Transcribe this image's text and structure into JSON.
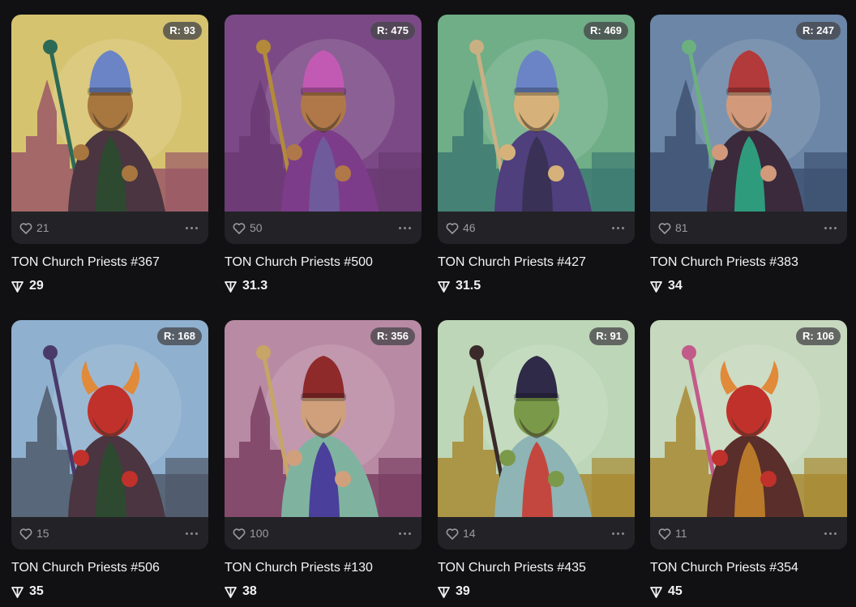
{
  "cards": [
    {
      "rank": "R: 93",
      "likes": "21",
      "title": "TON Church Priests #367",
      "price": "29",
      "bg": "#d6c36f",
      "horizon": "#9a5866",
      "robe": "#2d4a30",
      "coat": "#4a3541",
      "hat": "#6a84c6",
      "skin": "#a8763f",
      "staff": "#2d6a56",
      "figure": "priest"
    },
    {
      "rank": "R: 475",
      "likes": "50",
      "title": "TON Church Priests #500",
      "price": "31.3",
      "bg": "#7b4a86",
      "horizon": "#6b3a73",
      "robe": "#6f5a9c",
      "coat": "#7d3c8a",
      "hat": "#c25ab3",
      "skin": "#b07848",
      "staff": "#b38a3a",
      "figure": "priest"
    },
    {
      "rank": "R: 469",
      "likes": "46",
      "title": "TON Church Priests #427",
      "price": "31.5",
      "bg": "#6fae86",
      "horizon": "#3e7a72",
      "robe": "#3a3156",
      "coat": "#4f3f7d",
      "hat": "#6a84c6",
      "skin": "#d6b27a",
      "staff": "#c9b083",
      "figure": "priest"
    },
    {
      "rank": "R: 247",
      "likes": "81",
      "title": "TON Church Priests #383",
      "price": "34",
      "bg": "#6b86a7",
      "horizon": "#3e5272",
      "robe": "#2f9b7d",
      "coat": "#3a2a3c",
      "hat": "#b23a3a",
      "skin": "#d29a7a",
      "staff": "#6bb07e",
      "figure": "priest"
    },
    {
      "rank": "R: 168",
      "likes": "15",
      "title": "TON Church Priests #506",
      "price": "35",
      "bg": "#8fb0cf",
      "horizon": "#4f5a6a",
      "robe": "#2d4a30",
      "coat": "#4a3541",
      "hat": "#b52a2a",
      "skin": "#c0312b",
      "staff": "#4a3a6a",
      "figure": "devil"
    },
    {
      "rank": "R: 356",
      "likes": "100",
      "title": "TON Church Priests #130",
      "price": "38",
      "bg": "#b98aa3",
      "horizon": "#7a3f63",
      "robe": "#4a3f9a",
      "coat": "#7fb3a0",
      "hat": "#8f2a2a",
      "skin": "#d0a07c",
      "staff": "#c6a567",
      "figure": "priest"
    },
    {
      "rank": "R: 91",
      "likes": "14",
      "title": "TON Church Priests #435",
      "price": "39",
      "bg": "#bdd6b7",
      "horizon": "#a88a32",
      "robe": "#c4473f",
      "coat": "#8eb4b5",
      "hat": "#2e2a48",
      "skin": "#7a9a4a",
      "staff": "#3a2a2a",
      "figure": "priest"
    },
    {
      "rank": "R: 106",
      "likes": "11",
      "title": "TON Church Priests #354",
      "price": "45",
      "bg": "#c6d8bd",
      "horizon": "#a88a32",
      "robe": "#b87a2a",
      "coat": "#5a2e2a",
      "hat": "#b52a2a",
      "skin": "#c0312b",
      "staff": "#c25a8a",
      "figure": "devil"
    }
  ]
}
